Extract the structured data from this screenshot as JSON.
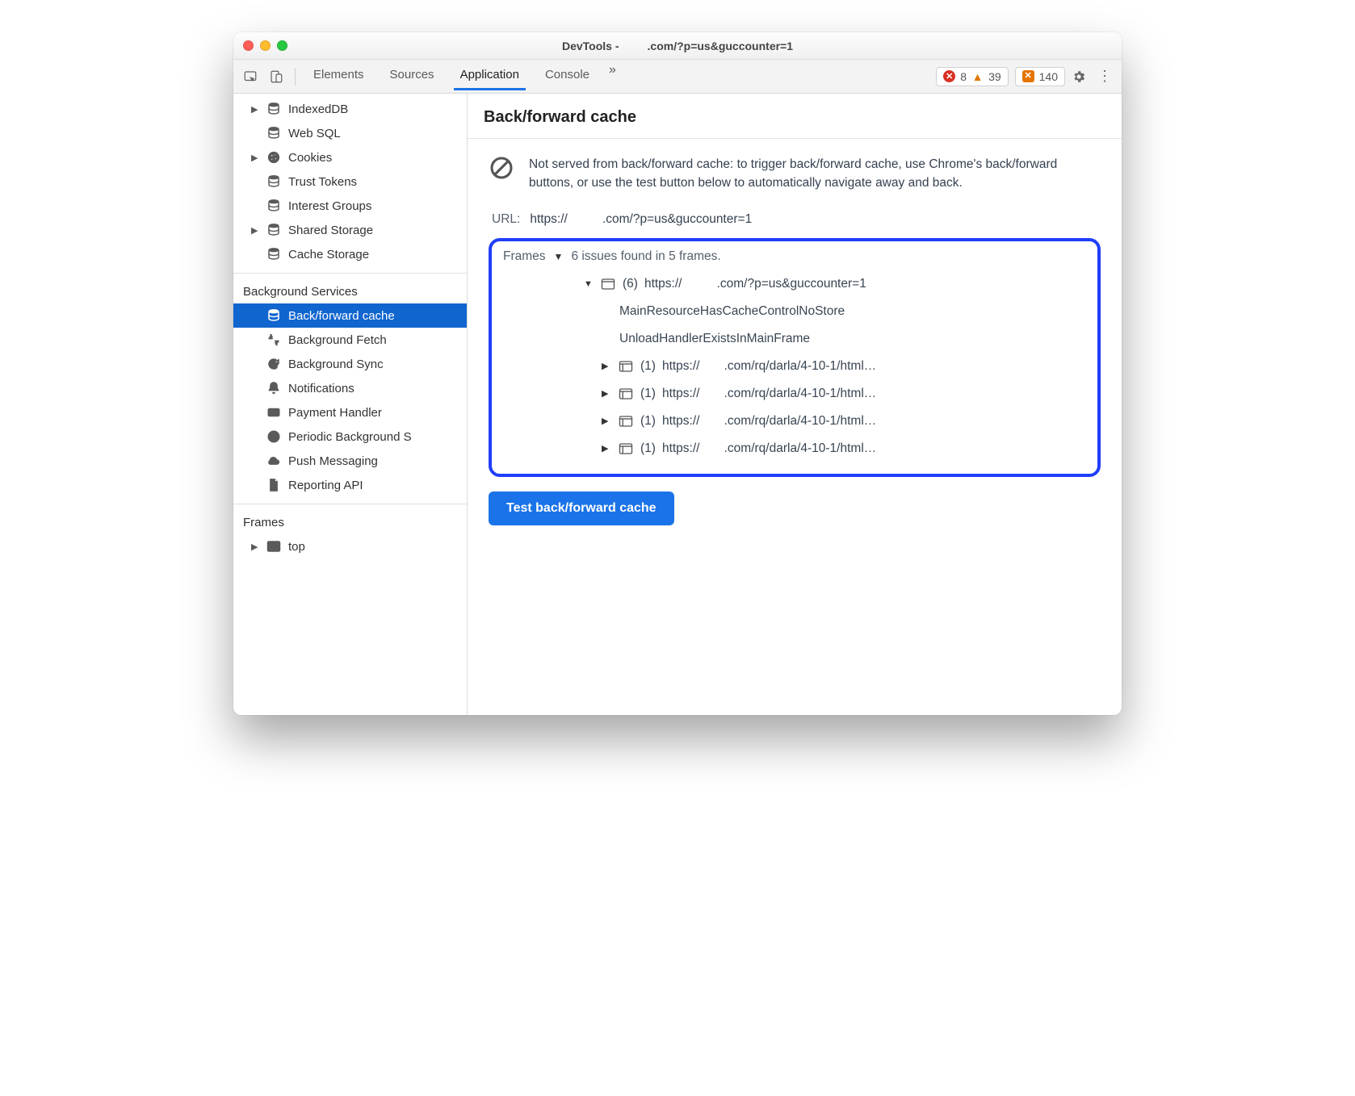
{
  "window": {
    "title_prefix": "DevTools - ",
    "title_suffix": ".com/?p=us&guccounter=1"
  },
  "toolbar": {
    "tabs": [
      "Elements",
      "Sources",
      "Application",
      "Console"
    ],
    "active_tab_index": 2,
    "errors_count": "8",
    "warnings_count": "39",
    "issues_count": "140"
  },
  "sidebar": {
    "storage_items": [
      {
        "label": "IndexedDB",
        "icon": "db",
        "expandable": true
      },
      {
        "label": "Web SQL",
        "icon": "db",
        "expandable": false
      },
      {
        "label": "Cookies",
        "icon": "cookie",
        "expandable": true
      },
      {
        "label": "Trust Tokens",
        "icon": "db",
        "expandable": false
      },
      {
        "label": "Interest Groups",
        "icon": "db",
        "expandable": false
      },
      {
        "label": "Shared Storage",
        "icon": "db",
        "expandable": true
      },
      {
        "label": "Cache Storage",
        "icon": "db",
        "expandable": false
      }
    ],
    "bg_heading": "Background Services",
    "bg_items": [
      {
        "label": "Back/forward cache",
        "icon": "db",
        "selected": true
      },
      {
        "label": "Background Fetch",
        "icon": "fetch"
      },
      {
        "label": "Background Sync",
        "icon": "sync"
      },
      {
        "label": "Notifications",
        "icon": "bell"
      },
      {
        "label": "Payment Handler",
        "icon": "card"
      },
      {
        "label": "Periodic Background S",
        "icon": "clock"
      },
      {
        "label": "Push Messaging",
        "icon": "cloud"
      },
      {
        "label": "Reporting API",
        "icon": "file"
      }
    ],
    "frames_heading": "Frames",
    "frames_items": [
      {
        "label": "top",
        "icon": "frame",
        "expandable": true
      }
    ]
  },
  "main": {
    "heading": "Back/forward cache",
    "notice": "Not served from back/forward cache: to trigger back/forward cache, use Chrome's back/forward buttons, or use the test button below to automatically navigate away and back.",
    "url_label": "URL:",
    "url_prefix": "https://",
    "url_suffix": ".com/?p=us&guccounter=1",
    "frames_label": "Frames",
    "frames_summary": "6 issues found in 5 frames.",
    "top_frame_count": "(6)",
    "top_frame_prefix": "https://",
    "top_frame_suffix": ".com/?p=us&guccounter=1",
    "reasons": [
      "MainResourceHasCacheControlNoStore",
      "UnloadHandlerExistsInMainFrame"
    ],
    "sub_count": "(1)",
    "sub_prefix": "https://",
    "sub_suffix": ".com/rq/darla/4-10-1/html…",
    "test_button": "Test back/forward cache"
  }
}
